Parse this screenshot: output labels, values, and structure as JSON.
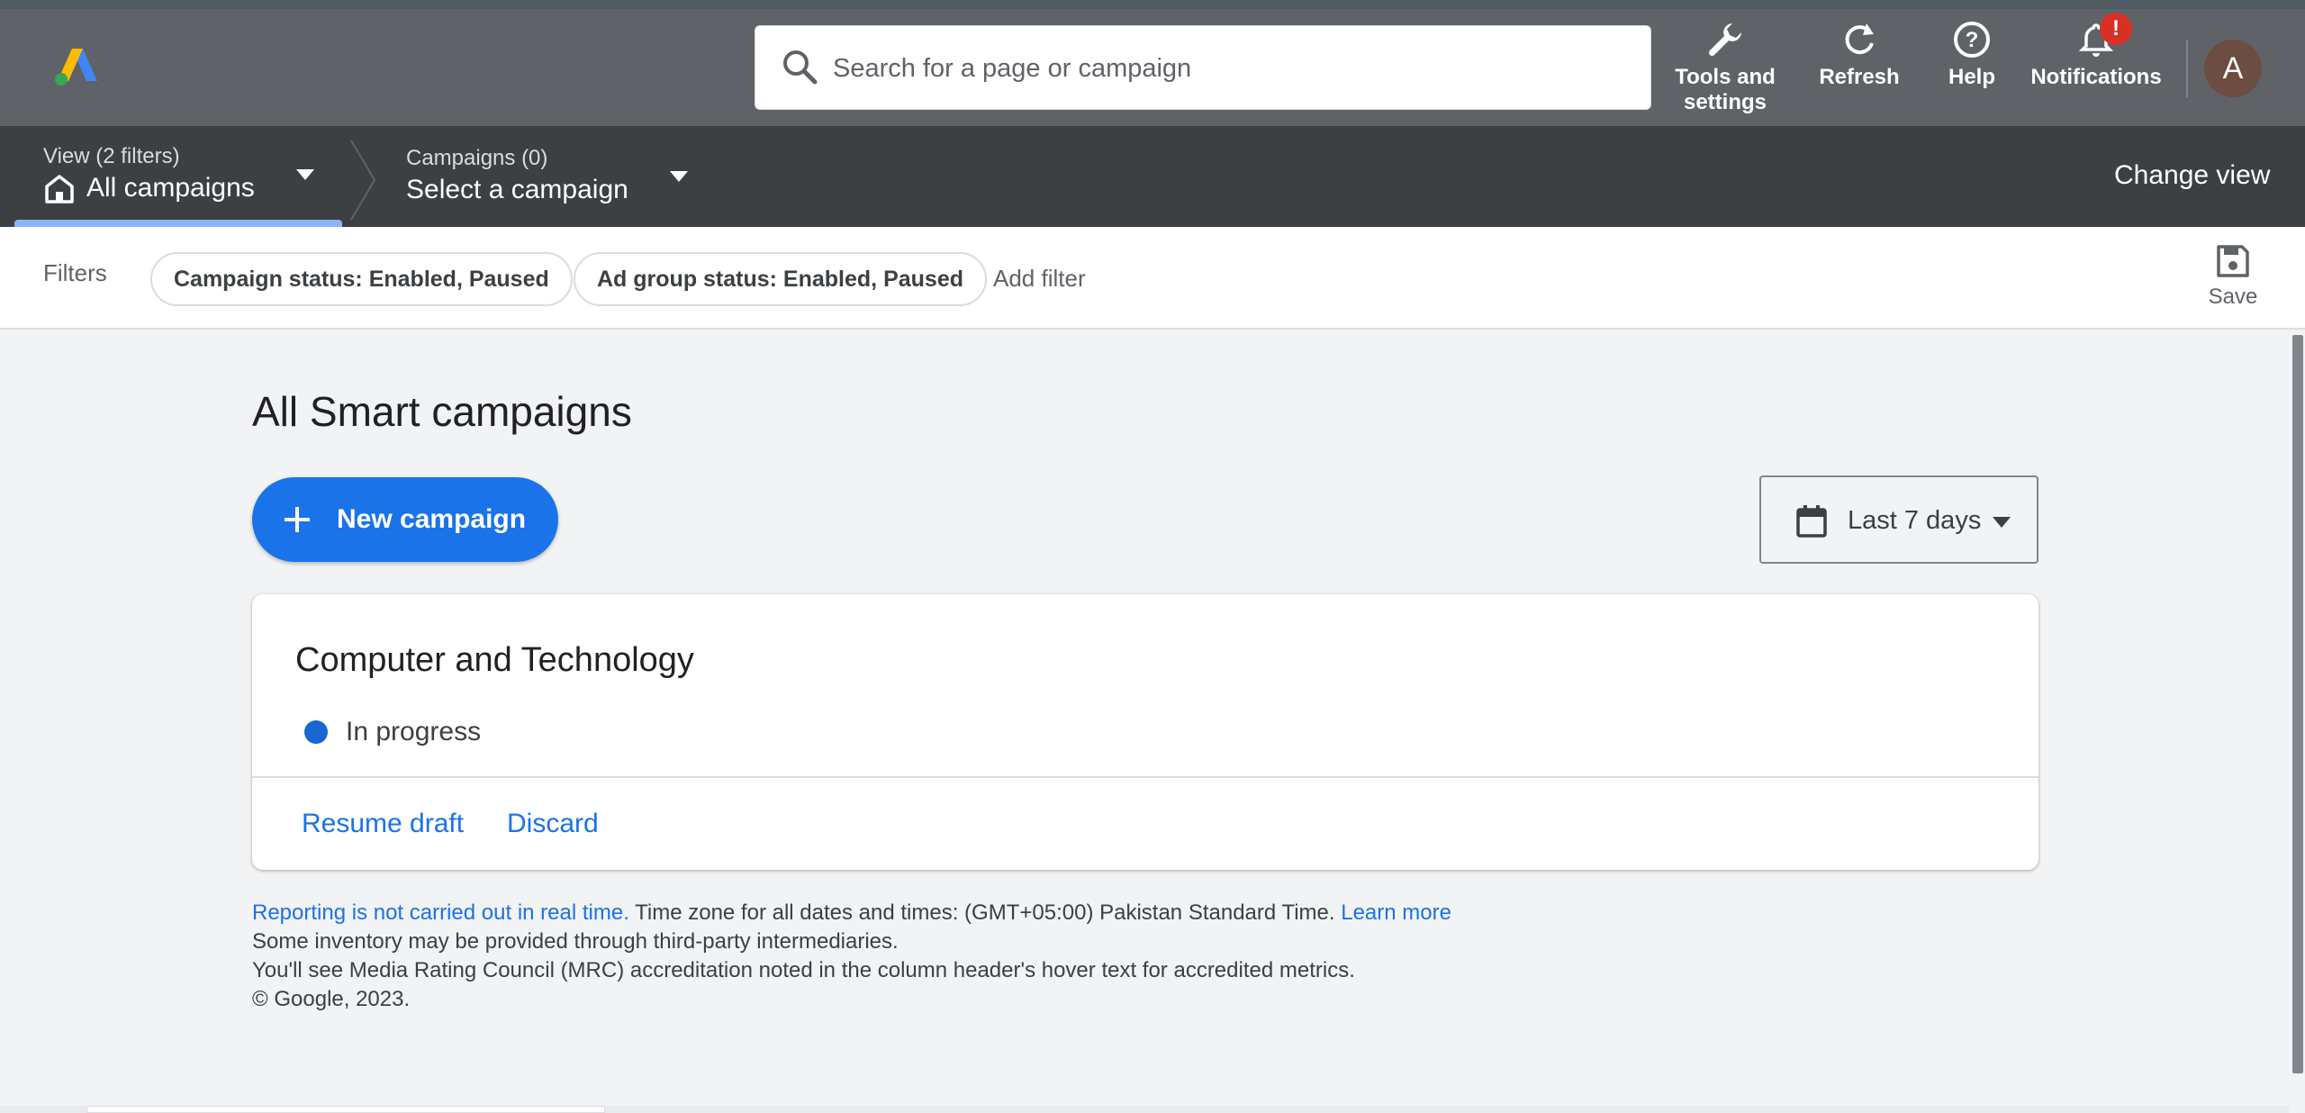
{
  "header": {
    "search_placeholder": "Search for a page or campaign",
    "tools_label_line1": "Tools and",
    "tools_label_line2": "settings",
    "refresh_label": "Refresh",
    "help_label": "Help",
    "notifications_label": "Notifications",
    "notification_badge": "!",
    "avatar_initial": "A"
  },
  "nav": {
    "view_label": "View (2 filters)",
    "view_value": "All campaigns",
    "campaigns_label": "Campaigns (0)",
    "campaigns_value": "Select a campaign",
    "change_view": "Change view"
  },
  "filters": {
    "label": "Filters",
    "chips": [
      "Campaign status: Enabled, Paused",
      "Ad group status: Enabled, Paused"
    ],
    "add_filter": "Add filter",
    "save_label": "Save"
  },
  "main": {
    "title": "All Smart campaigns",
    "new_campaign": "New campaign",
    "date_range": "Last 7 days",
    "card": {
      "title": "Computer and Technology",
      "status": "In progress",
      "resume": "Resume draft",
      "discard": "Discard"
    },
    "footer": {
      "reporting_link": "Reporting is not carried out in real time.",
      "timezone": " Time zone for all dates and times: (GMT+05:00) Pakistan Standard Time. ",
      "learn_more": "Learn more",
      "line2": "Some inventory may be provided through third-party intermediaries.",
      "line3": "You'll see Media Rating Council (MRC) accreditation noted in the column header's hover text for accredited metrics.",
      "line4": "© Google, 2023."
    }
  },
  "colors": {
    "header_bg": "#5f6368",
    "nav_bg": "#3c4043",
    "accent_blue": "#1a73e8",
    "status_blue": "#1967d2",
    "badge_red": "#d93025"
  },
  "icons": [
    "google-ads-logo",
    "search-icon",
    "wrench-icon",
    "refresh-icon",
    "help-icon",
    "bell-icon",
    "home-icon",
    "dropdown-caret-icon",
    "save-icon",
    "plus-icon",
    "calendar-icon"
  ]
}
